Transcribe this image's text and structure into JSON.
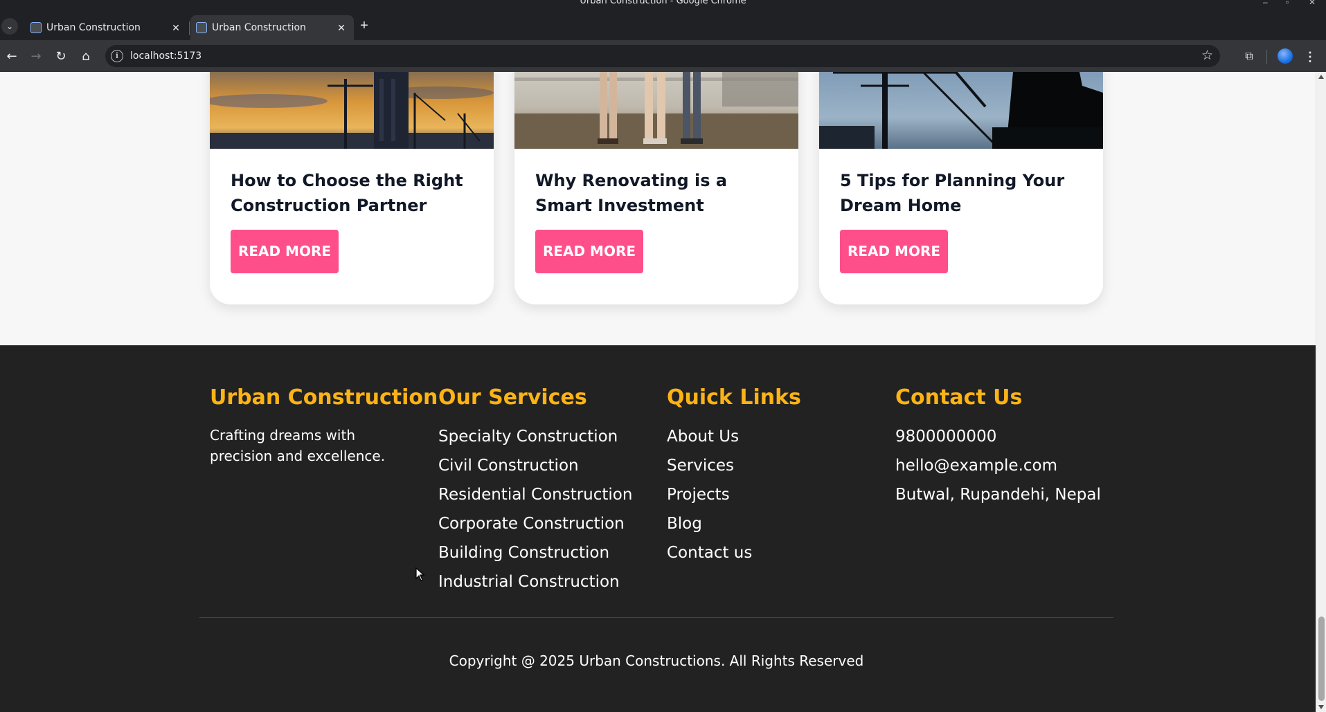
{
  "browser": {
    "window_title": "Urban Construction - Google Chrome",
    "tabs": [
      {
        "title": "Urban Construction",
        "active": false
      },
      {
        "title": "Urban Construction",
        "active": true
      }
    ],
    "url": "localhost:5173"
  },
  "blog": {
    "cards": [
      {
        "title": "How to Choose the Right Construction Partner",
        "button": "READ MORE"
      },
      {
        "title": "Why Renovating is a Smart Investment",
        "button": "READ MORE"
      },
      {
        "title": "5 Tips for Planning Your Dream Home",
        "button": "READ MORE"
      }
    ]
  },
  "footer": {
    "brand": {
      "heading": "Urban Construction",
      "tagline": "Crafting dreams with precision and excellence."
    },
    "services": {
      "heading": "Our Services",
      "items": [
        "Specialty Construction",
        "Civil Construction",
        "Residential Construction",
        "Corporate Construction",
        "Building Construction",
        "Industrial Construction"
      ]
    },
    "quick_links": {
      "heading": "Quick Links",
      "items": [
        "About Us",
        "Services",
        "Projects",
        "Blog",
        "Contact us"
      ]
    },
    "contact": {
      "heading": "Contact Us",
      "items": [
        "9800000000",
        "hello@example.com",
        "Butwal, Rupandehi, Nepal"
      ]
    },
    "copyright": "Copyright @ 2025 Urban Constructions. All Rights Reserved"
  },
  "colors": {
    "accent_pink": "#ff4f8b",
    "footer_heading": "#fcb316",
    "footer_bg": "#222222"
  }
}
